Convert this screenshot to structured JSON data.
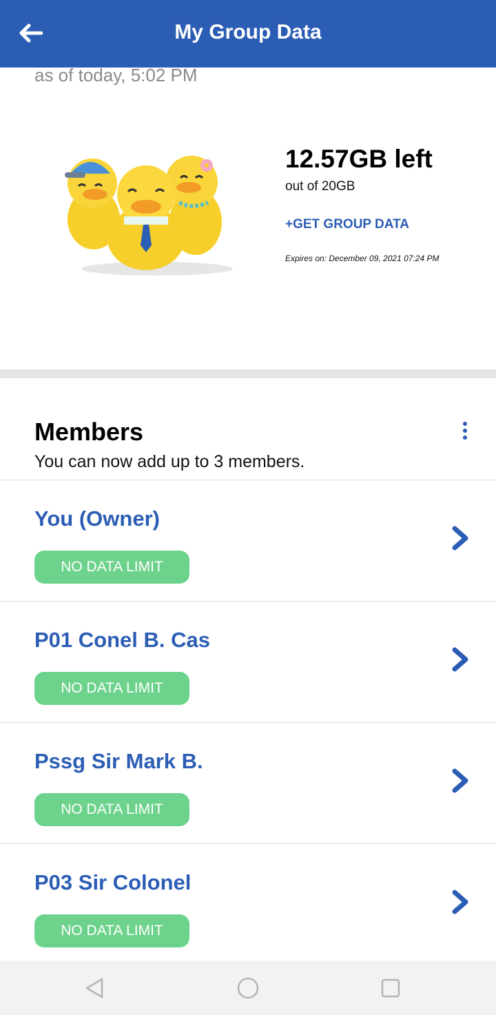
{
  "header": {
    "title": "My Group Data",
    "back_icon": "back-arrow-icon"
  },
  "summary": {
    "as_of": "as of today, 5:02 PM",
    "data_left": "12.57GB left",
    "total": "out of 20GB",
    "get_data_label": "+GET GROUP DATA",
    "expires": "Expires on: December 09, 2021 07:24 PM",
    "illustration": "three-ducks-illustration"
  },
  "members": {
    "title": "Members",
    "subtitle": "You can now add up to 3 members.",
    "menu_icon": "more-vertical-icon",
    "items": [
      {
        "name": "You (Owner)",
        "badge": "NO DATA LIMIT"
      },
      {
        "name": "P01 Conel B. Cas",
        "badge": "NO DATA LIMIT"
      },
      {
        "name": "Pssg Sir Mark B.",
        "badge": "NO DATA LIMIT"
      },
      {
        "name": "P03 Sir Colonel",
        "badge": "NO DATA LIMIT"
      }
    ]
  },
  "colors": {
    "brand": "#2c5db4",
    "badge": "#6dd28b",
    "divider": "#e4e4e4"
  },
  "system_nav": {
    "back": "nav-back-icon",
    "home": "nav-home-icon",
    "recents": "nav-recents-icon"
  }
}
